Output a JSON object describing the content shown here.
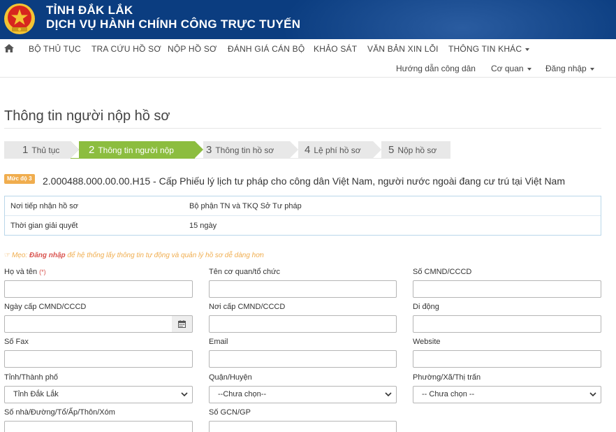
{
  "header": {
    "line1": "TỈNH ĐẮK LẮK",
    "line2": "DỊCH VỤ HÀNH CHÍNH CÔNG TRỰC TUYẾN",
    "colors": {
      "banner": "#0b3d80",
      "emblem_red": "#d7261e",
      "emblem_gold": "#f3c433"
    }
  },
  "nav": {
    "home_icon": "home-icon",
    "items": [
      "BỘ THỦ TỤC",
      "TRA CỨU HỒ SƠ",
      "NỘP HỒ SƠ",
      "ĐÁNH GIÁ CÁN BỘ",
      "KHẢO SÁT",
      "VĂN BẢN XIN LỖI",
      "THÔNG TIN KHÁC"
    ],
    "secondary": [
      "Hướng dẫn công dân",
      "Cơ quan",
      "Đăng nhập"
    ]
  },
  "page": {
    "title": "Thông tin người nộp hồ sơ"
  },
  "steps": [
    {
      "num": "1",
      "label": "Thủ tục"
    },
    {
      "num": "2",
      "label": "Thông tin người nộp"
    },
    {
      "num": "3",
      "label": "Thông tin hồ sơ"
    },
    {
      "num": "4",
      "label": "Lệ phí hồ sơ"
    },
    {
      "num": "5",
      "label": "Nộp hồ sơ"
    }
  ],
  "active_step": "2",
  "procedure": {
    "level": "Mức độ 3",
    "title": "2.000488.000.00.00.H15 - Cấp Phiếu lý lịch tư pháp cho công dân Việt Nam, người nước ngoài đang cư trú tại Việt Nam"
  },
  "info": [
    {
      "key": "Nơi tiếp nhận hồ sơ",
      "value": "Bộ phận TN và TKQ Sở Tư pháp"
    },
    {
      "key": "Thời gian giải quyết",
      "value": "15 ngày"
    }
  ],
  "tip": {
    "prefix": "Mẹo: ",
    "login": "Đăng nhập",
    "suffix": " để hệ thống lấy thông tin tự động và quản lý hồ sơ dễ dàng hơn"
  },
  "form": {
    "required_mark": "(*)",
    "fields": {
      "ho_ten": {
        "label": "Họ và tên",
        "value": ""
      },
      "co_quan": {
        "label": "Tên cơ quan/tổ chức",
        "value": ""
      },
      "cmnd": {
        "label": "Số CMND/CCCD",
        "value": ""
      },
      "ngay_cap": {
        "label": "Ngày cấp CMND/CCCD",
        "value": ""
      },
      "noi_cap": {
        "label": "Nơi cấp CMND/CCCD",
        "value": ""
      },
      "di_dong": {
        "label": "Di động",
        "value": ""
      },
      "fax": {
        "label": "Số Fax",
        "value": ""
      },
      "email": {
        "label": "Email",
        "value": ""
      },
      "website": {
        "label": "Website",
        "value": ""
      },
      "tinh": {
        "label": "Tỉnh/Thành phố",
        "selected": "Tỉnh Đắk Lắk"
      },
      "quan": {
        "label": "Quận/Huyện",
        "selected": "--Chưa chọn--"
      },
      "phuong": {
        "label": "Phường/Xã/Thị trấn",
        "selected": "-- Chưa chọn --"
      },
      "dia_chi": {
        "label": "Số nhà/Đường/Tổ/Ấp/Thôn/Xóm",
        "value": ""
      },
      "gcn": {
        "label": "Số GCN/GP",
        "value": ""
      }
    }
  }
}
